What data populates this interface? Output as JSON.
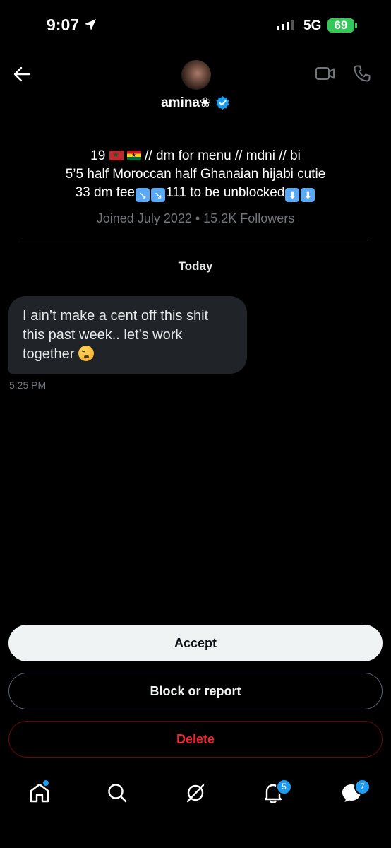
{
  "status_bar": {
    "time": "9:07",
    "network": "5G",
    "battery": "69"
  },
  "header": {
    "name": "amina❀"
  },
  "bio": {
    "line1_prefix": "19",
    "line1_suffix": "// dm for menu // mdni // bi",
    "line2": "5’5 half Moroccan half Ghanaian hijabi cutie",
    "line3_a": "33 dm fee",
    "line3_b": "111 to be unblocked",
    "kbox_diag": "↘",
    "kbox_down": "⬇"
  },
  "meta": "Joined July 2022 • 15.2K Followers",
  "day_separator": "Today",
  "message": {
    "text": "I ain’t make a cent off this shit this past week.. let’s work together",
    "time": "5:25 PM"
  },
  "actions": {
    "accept": "Accept",
    "block": "Block or report",
    "delete": "Delete"
  },
  "nav": {
    "notifications_badge": "5",
    "messages_badge": "7"
  },
  "colors": {
    "accent": "#1d9bf0",
    "danger": "#f4212e",
    "battery": "#34c759"
  }
}
